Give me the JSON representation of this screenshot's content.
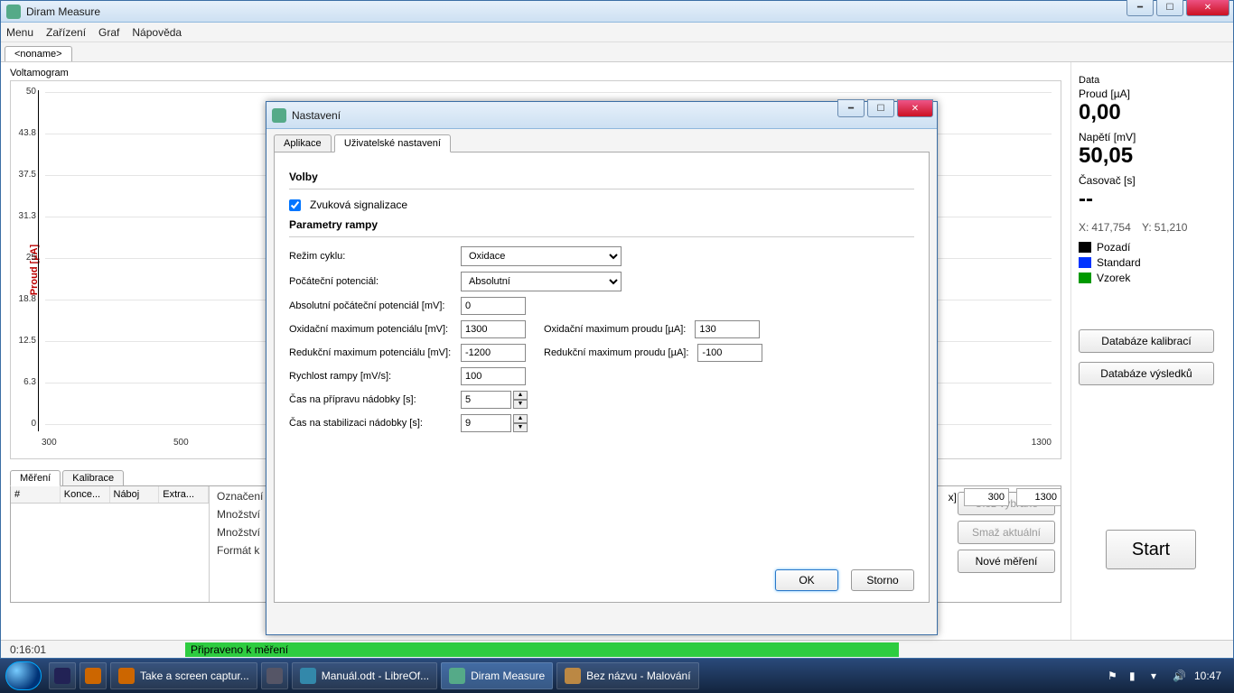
{
  "app": {
    "title": "Diram Measure"
  },
  "menu": {
    "items": [
      "Menu",
      "Zařízení",
      "Graf",
      "Nápověda"
    ]
  },
  "file_tab": "<noname>",
  "chart": {
    "title": "Voltamogram",
    "ylabel": "Proud [µA]"
  },
  "chart_data": {
    "type": "line",
    "title": "Voltamogram",
    "xlabel": "",
    "ylabel": "Proud [µA]",
    "xlim": [
      300,
      1300
    ],
    "ylim": [
      0.0,
      50.0
    ],
    "yticks": [
      50.0,
      43.8,
      37.5,
      31.3,
      25.0,
      18.8,
      12.5,
      6.3,
      0.0
    ],
    "xticks": [
      300,
      500,
      1300
    ],
    "series": []
  },
  "lower_tabs": {
    "mereni": "Měření",
    "kalibrace": "Kalibrace"
  },
  "table": {
    "cols": [
      "#",
      "Konce...",
      "Náboj",
      "Extra..."
    ]
  },
  "form_labels": {
    "oznaceni": "Označení vzorku",
    "mnozstvi1": "Množství",
    "mnozstvi2": "Množství",
    "format": "Formát k"
  },
  "side_buttons": {
    "uloz": "Ulož vybrané",
    "smaz": "Smaž aktuální",
    "nove": "Nové měření"
  },
  "range": {
    "label_hidden": "x]",
    "min": "300",
    "max": "1300"
  },
  "data_panel": {
    "title": "Data",
    "proud_label": "Proud [µA]",
    "proud_value": "0,00",
    "napeti_label": "Napětí [mV]",
    "napeti_value": "50,05",
    "casovac_label": "Časovač [s]",
    "casovac_value": "--",
    "coords_x_label": "X:",
    "coords_x": "417,754",
    "coords_y_label": "Y:",
    "coords_y": "51,210",
    "legend": [
      {
        "color": "#000000",
        "label": "Pozadí"
      },
      {
        "color": "#0033ff",
        "label": "Standard"
      },
      {
        "color": "#009900",
        "label": "Vzorek"
      }
    ],
    "db_kalibraci": "Databáze kalibrací",
    "db_vysledku": "Databáze výsledků",
    "start": "Start"
  },
  "status": {
    "time": "0:16:01",
    "msg": "Připraveno k měření"
  },
  "modal": {
    "title": "Nastavení",
    "tabs": {
      "app": "Aplikace",
      "user": "Uživatelské nastavení"
    },
    "volby_head": "Volby",
    "zvuk_label": "Zvuková signalizace",
    "zvuk_checked": true,
    "param_head": "Parametry rampy",
    "fields": {
      "rezim_label": "Režim cyklu:",
      "rezim_value": "Oxidace",
      "pocatecni_label": "Počáteční potenciál:",
      "pocatecni_value": "Absolutní",
      "abs_pot_label": "Absolutní počáteční potenciál [mV]:",
      "abs_pot_value": "0",
      "ox_pot_label": "Oxidační maximum potenciálu [mV]:",
      "ox_pot_value": "1300",
      "ox_cur_label": "Oxidační maximum proudu [µA]:",
      "ox_cur_value": "130",
      "red_pot_label": "Redukční maximum potenciálu [mV]:",
      "red_pot_value": "-1200",
      "red_cur_label": "Redukční maximum proudu [µA]:",
      "red_cur_value": "-100",
      "rychlost_label": "Rychlost rampy [mV/s]:",
      "rychlost_value": "100",
      "priprava_label": "Čas na přípravu nádobky [s]:",
      "priprava_value": "5",
      "stabil_label": "Čas na stabilizaci nádobky [s]:",
      "stabil_value": "9"
    },
    "ok": "OK",
    "storno": "Storno"
  },
  "taskbar": {
    "items": [
      "Take a screen captur...",
      "Manuál.odt - LibreOf...",
      "Diram Measure",
      "Bez názvu - Malování"
    ],
    "clock": "10:47"
  }
}
